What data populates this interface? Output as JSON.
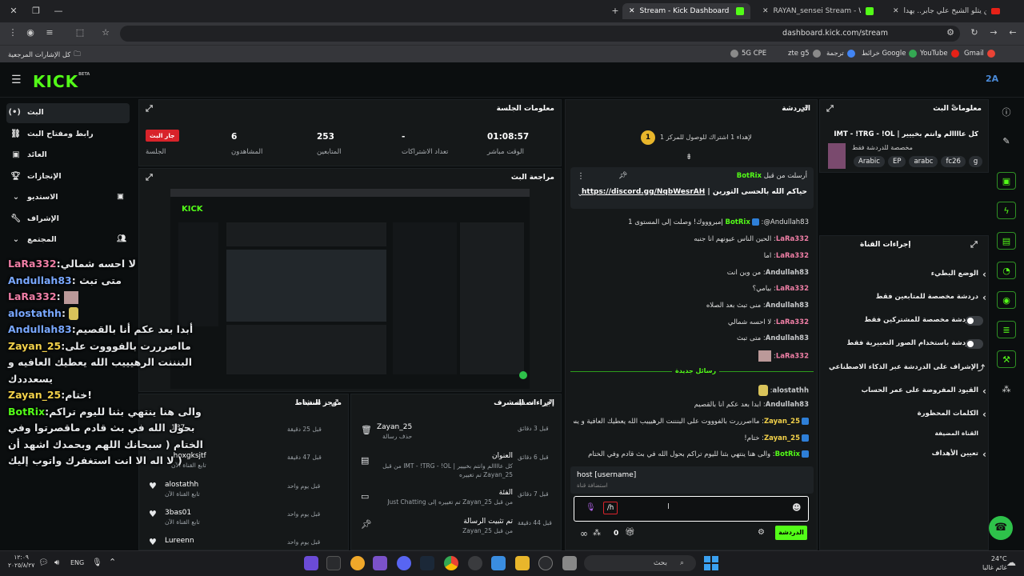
{
  "browser": {
    "tabs": [
      {
        "label": "حين يتلو الشيخ علي جابر.. يهدأ..."
      },
      {
        "label": "RAYAN_sensei Stream - Watch Live"
      },
      {
        "label": "Stream - Kick Dashboard"
      }
    ],
    "address": "dashboard.kick.com/stream",
    "bookmarks_all": "كل الإشارات المرجعية",
    "bookmarks": [
      "Gmail",
      "YouTube",
      "خرائط Google",
      "ترجمة",
      "zte g5",
      "5G CPE"
    ]
  },
  "app": {
    "logo": "KICK",
    "logo_beta": "BETA",
    "avatar": "2A"
  },
  "sidebar": {
    "items": [
      {
        "label": "البث",
        "icon": "broadcast-icon"
      },
      {
        "label": "رابط ومفتاح البث",
        "icon": "link-icon"
      },
      {
        "label": "العائد",
        "icon": "money-icon"
      },
      {
        "label": "الإنجازات",
        "icon": "trophy-icon"
      },
      {
        "label": "الاستديو",
        "icon": "chevron-down-icon"
      },
      {
        "label": "الإشراف",
        "icon": "wrench-icon"
      },
      {
        "label": "المجتمع",
        "icon": "chevron-down-icon"
      }
    ]
  },
  "session": {
    "title": "معلومات الجلسة",
    "live_badge": "جار البث",
    "live_label": "الجلسة",
    "viewers_value": "6",
    "viewers_label": "المشاهدون",
    "followers_value": "253",
    "followers_label": "المتابعين",
    "subs_value": "-",
    "subs_label": "تعداد الاشتراكات",
    "uptime_value": "01:08:57",
    "uptime_label": "الوقت مباشر"
  },
  "preview": {
    "title": "مراجعة البث"
  },
  "activity": {
    "title": "موجز النشاط",
    "filter": "تصفية",
    "rows": [
      {
        "name": "_187",
        "sub": "",
        "time": "قبل 25 دقيقة"
      },
      {
        "name": "hoxgksjtf",
        "sub": "تابع القناة الآن",
        "time": "قبل 47 دقيقة"
      },
      {
        "name": "alostathh",
        "sub": "تابع القناة الآن",
        "time": "قبل يوم واحد"
      },
      {
        "name": "3bas01",
        "sub": "تابع القناة الآن",
        "time": "قبل يوم واحد"
      },
      {
        "name": "Lureenn",
        "sub": "",
        "time": "قبل يوم واحد"
      }
    ]
  },
  "modlog": {
    "title": "إجراءات المشرف",
    "filter": "تصفية",
    "rows": [
      {
        "title": "Zayan_25",
        "sub": "حذف رسالة",
        "time": "قبل 3 دقائق"
      },
      {
        "title": "العنوان",
        "sub": "كل عاااالم وانتم بخييير | IMT - !TRG - !OL من قبل Zayan_25 تم تغييره",
        "time": "قبل 6 دقائق"
      },
      {
        "title": "الفئة",
        "sub": "من قبل Zayan_25 تم تغييره إلى Just Chatting",
        "time": "قبل 7 دقائق"
      },
      {
        "title": "تم تثبيت الرسالة",
        "sub": "من قبل Zayan_25",
        "time": "قبل 44 دقيقة"
      }
    ]
  },
  "chat": {
    "title": "الدردشة",
    "goal": "لإهداء 1 اشتراك للوصول للمركز 1",
    "goal_rank": "1",
    "pinned_by": "أرسلت من قبل",
    "pinned_user": "BotRix",
    "pinned_text": "حياكم الله بالحسى التورين |",
    "pinned_link": "https://discord.gg/NqbWesrAH",
    "messages": [
      {
        "user": "BotRix",
        "text": ":@Andullah83 إمبروووك! وصلت إلى المستوى 1",
        "color": "green"
      },
      {
        "user": "LaRa332",
        "text": "الحين الناس عيونهم انا جنبه",
        "color": "pink"
      },
      {
        "user": "LaRa332",
        "text": "اما",
        "color": "pink"
      },
      {
        "user": "Andullah83",
        "text": "من وين انت",
        "color": "gray"
      },
      {
        "user": "LaRa332",
        "text": "بيامي؟",
        "color": "pink"
      },
      {
        "user": "Andullah83",
        "text": "منى تبث بعد الصلاه",
        "color": "gray"
      },
      {
        "user": "LaRa332",
        "text": "لا احسه شمالي",
        "color": "pink"
      },
      {
        "user": "Andullah83",
        "text": "متى تبث",
        "color": "gray"
      },
      {
        "user": "LaRa332",
        "text": "",
        "color": "pink"
      }
    ],
    "new_messages": "رسائل جديدة",
    "messages2": [
      {
        "user": "alostathh",
        "text": "",
        "color": "gray"
      },
      {
        "user": "Andullah83",
        "text": "ابدا بعد عكم أنا بالقصيم",
        "color": "gray"
      },
      {
        "user": "Zayan_25",
        "text": "مااصرررت بالفوووت على البنننت الرهيييب الله يعطيك العافية و يسعدددك",
        "color": "yellow"
      },
      {
        "user": "Zayan_25",
        "text": "ختام!",
        "color": "yellow"
      },
      {
        "user": "BotRix",
        "text": "والى هنا ينتهي بثنا لليوم تراكم بحول الله في بث قادم وفي الختام",
        "color": "green"
      }
    ],
    "suggest_cmd": "host [username]",
    "suggest_desc": "استضافة قناة",
    "input_value": "/h",
    "count": "0",
    "send": "الدردشة"
  },
  "streaminfo": {
    "title": "معلومات البث",
    "stream_title": "كل عاااالم وانتم بخييير | IMT - !TRG - !OL",
    "category": "مخصصة للدردشة فقط",
    "tags": [
      "Arabic",
      "EP",
      "arabc",
      "fc26",
      "g"
    ]
  },
  "channel_actions": {
    "title": "إجراءات القناة",
    "items": [
      {
        "label": "الوضع البطيء",
        "control": "chevron"
      },
      {
        "label": "دردشة مخصصة للمتابعين فقط",
        "control": "chevron"
      },
      {
        "label": "الدردشة مخصصة للمشتركين فقط",
        "control": "toggle"
      },
      {
        "label": "الدردشة باستخدام الصور التعبيرية فقط",
        "control": "toggle"
      },
      {
        "label": "الإشراف على الدردشة عبر الذكاء الاصطناعي",
        "control": "link"
      },
      {
        "label": "القيود المفروضة على عمر الحساب",
        "control": "chevron"
      },
      {
        "label": "الكلمات المحظورة",
        "control": "chevron"
      },
      {
        "label": "القناة المضيفة",
        "control": "none"
      },
      {
        "label": "تعيين الأهداف",
        "control": "chevron"
      }
    ]
  },
  "overlay": {
    "lines": [
      {
        "user": "LaRa332",
        "text": ":لا احسه شمالي",
        "color": "#f07fa6"
      },
      {
        "user": "Andullah83",
        "text": ": متى تبث",
        "color": "#79a8ff"
      },
      {
        "user": "LaRa332",
        "text": ":",
        "color": "#f07fa6"
      },
      {
        "user": "alostathh",
        "text": ":",
        "color": "#79a8ff"
      },
      {
        "user": "Andullah83",
        "text": ":أبدا بعد عكم أنا بالقصيم",
        "color": "#79a8ff"
      },
      {
        "user": "Zayan_25",
        "text": ":مااصرررت بالفوووت على",
        "color": "#f2d14a"
      },
      {
        "user": "",
        "text": "البنننت الرهيييب الله يعطيك العافيه و",
        "color": "#fff"
      },
      {
        "user": "",
        "text": "يسعدددك",
        "color": "#fff"
      },
      {
        "user": "Zayan_25",
        "text": ":ختام!",
        "color": "#f2d14a"
      },
      {
        "user": "BotRix",
        "text": ":والى هنا ينتهي بثنا لليوم تراكم",
        "color": "#53fc18"
      },
      {
        "user": "",
        "text": "بحول الله في بث قادم ماقصرتوا وفي",
        "color": "#fff"
      },
      {
        "user": "",
        "text": "الختام ( سبحانك اللهم وبحمدك اشهد أن",
        "color": "#fff"
      },
      {
        "user": "",
        "text": "لا اله الا انت استغفرك واتوب إليك )",
        "color": "#fff"
      }
    ]
  },
  "taskbar": {
    "search": "بحث",
    "weather_temp": "24°C",
    "weather_desc": "غائم غالبا",
    "lang": "ENG",
    "time": "١٢:٠٩",
    "date": "٢٠٢٥/٨/٢٧"
  },
  "colors": {
    "accent": "#53fc18",
    "live": "#d8232a",
    "bg": "#0b0e0f",
    "panel": "#151819"
  }
}
